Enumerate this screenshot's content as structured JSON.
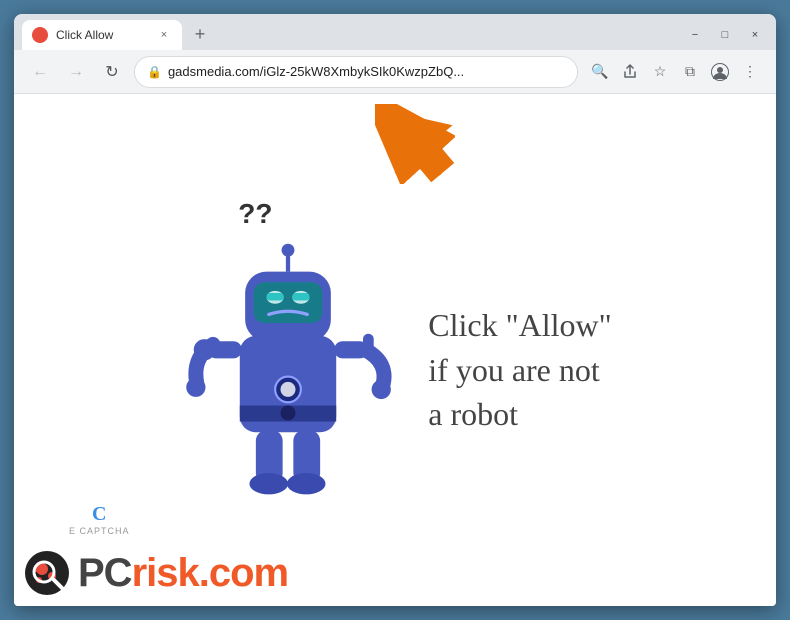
{
  "browser": {
    "tab": {
      "title": "Click Allow",
      "favicon_color": "#e74c3c",
      "close_label": "×",
      "new_tab_label": "+"
    },
    "window_controls": {
      "minimize": "−",
      "maximize": "□",
      "close": "×"
    },
    "toolbar": {
      "back_arrow": "←",
      "forward_arrow": "→",
      "refresh": "↻",
      "address": "gadsmedia.com/iGlz-25kW8XmbykSIk0KwzpZbQ...",
      "search_icon": "🔍",
      "share_icon": "↗",
      "bookmark_icon": "☆",
      "tab_search_icon": "⧉",
      "profile_icon": "👤",
      "menu_icon": "⋮"
    },
    "page": {
      "main_text_line1": "Click \"Allow\"",
      "main_text_line2": "if you are not",
      "main_text_line3": "a robot",
      "question_marks": "??",
      "ecaptcha_label": "E CAPTCHA",
      "logo_pc": "PC",
      "logo_risk": "risk.com"
    }
  }
}
